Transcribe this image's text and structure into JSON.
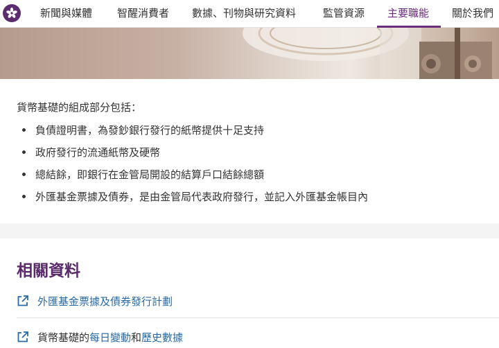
{
  "nav": {
    "items": [
      {
        "label": "新聞與媒體"
      },
      {
        "label": "智醒消費者"
      },
      {
        "label": "數據、刊物與研究資料"
      },
      {
        "label": "監管資源"
      },
      {
        "label": "主要職能"
      },
      {
        "label": "關於我們"
      }
    ],
    "active_index": 4
  },
  "content": {
    "intro": "貨幣基礎的組成部分包括：",
    "bullets": [
      "負債證明書，為發鈔銀行發行的紙幣提供十足支持",
      "政府發行的流通紙幣及硬幣",
      "總結餘，即銀行在金管局開設的結算戶口結餘總額",
      "外匯基金票據及債券，是由金管局代表政府發行，並記入外匯基金帳目內"
    ]
  },
  "related": {
    "title": "相關資料",
    "link1": "外匯基金票據及債券發行計劃",
    "link2": {
      "prefix": "貨幣基礎的",
      "daily": "每日變動",
      "and": "和",
      "history": "歷史數據"
    }
  },
  "colors": {
    "brand_purple": "#6a2c7d",
    "link_blue": "#2a6aa4"
  }
}
